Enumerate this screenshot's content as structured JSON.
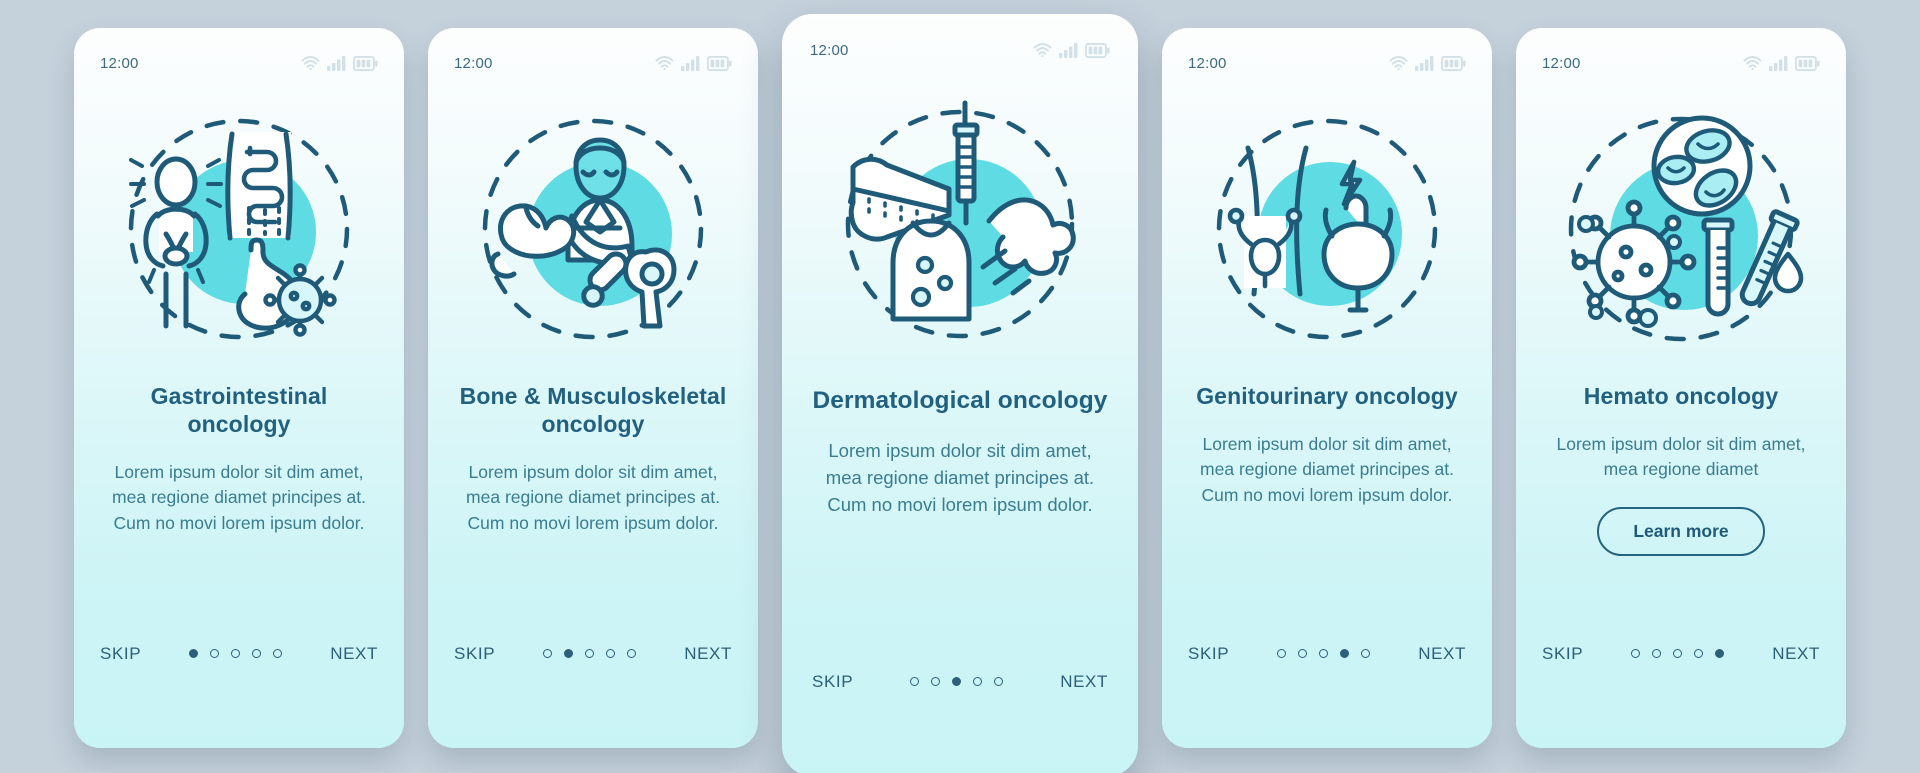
{
  "background_color": "#c5d1db",
  "theme": {
    "accent": "#4fd6e0",
    "ink": "#226080",
    "body_text": "#3a7d90",
    "nav_text": "#2c5f7a",
    "card_gradient_top": "#fdfefe",
    "card_gradient_bottom": "#c9f4f6"
  },
  "status_bar": {
    "time": "12:00",
    "icons": [
      "wifi-icon",
      "cellular-signal-icon",
      "battery-icon"
    ]
  },
  "nav": {
    "skip_label": "SKIP",
    "next_label": "NEXT",
    "dot_count": 5
  },
  "screens": [
    {
      "id": "gastrointestinal",
      "featured": false,
      "illustration": "gastrointestinal-oncology-illustration",
      "title": "Gastrointestinal oncology",
      "description": "Lorem ipsum dolor sit dim amet, mea regione diamet principes at. Cum no movi lorem ipsum dolor.",
      "active_dot": 1,
      "has_learn_more": false,
      "has_nav": true
    },
    {
      "id": "bone-musculoskeletal",
      "featured": false,
      "illustration": "bone-musculoskeletal-oncology-illustration",
      "title": "Bone & Musculoskeletal oncology",
      "description": "Lorem ipsum dolor sit dim amet, mea regione diamet principes at. Cum no movi lorem ipsum dolor.",
      "active_dot": 2,
      "has_learn_more": false,
      "has_nav": true
    },
    {
      "id": "dermatological",
      "featured": true,
      "illustration": "dermatological-oncology-illustration",
      "title": "Dermatological oncology",
      "description": "Lorem ipsum dolor sit dim amet, mea regione diamet principes at. Cum no movi lorem ipsum dolor.",
      "active_dot": 3,
      "has_learn_more": false,
      "has_nav": true
    },
    {
      "id": "genitourinary",
      "featured": false,
      "illustration": "genitourinary-oncology-illustration",
      "title": "Genitourinary oncology",
      "description": "Lorem ipsum dolor sit dim amet, mea regione diamet principes at. Cum no movi lorem ipsum dolor.",
      "active_dot": 4,
      "has_learn_more": false,
      "has_nav": true
    },
    {
      "id": "hemato",
      "featured": false,
      "illustration": "hemato-oncology-illustration",
      "title": "Hemato oncology",
      "description": "Lorem ipsum dolor sit dim amet, mea regione diamet",
      "active_dot": 5,
      "has_learn_more": true,
      "learn_more_label": "Learn more",
      "has_nav": true
    }
  ]
}
